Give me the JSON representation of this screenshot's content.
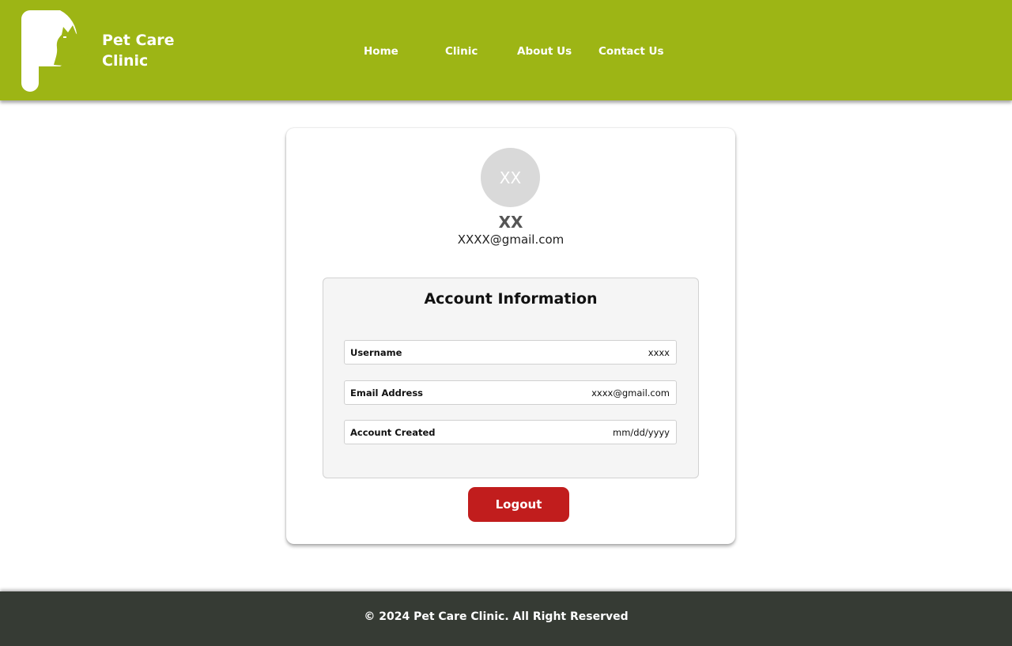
{
  "brand": {
    "line1": "Pet Care",
    "line2": "Clinic",
    "logo_icon": "pet-clinic-logo-icon"
  },
  "nav": {
    "items": [
      {
        "label": "Home"
      },
      {
        "label": "Clinic"
      },
      {
        "label": "About Us"
      },
      {
        "label": "Contact Us"
      }
    ]
  },
  "profile": {
    "avatar_initials": "XX",
    "name": "XX",
    "email": "XXXX@gmail.com"
  },
  "account_info": {
    "title": "Account Information",
    "rows": [
      {
        "label": "Username",
        "value": "xxxx"
      },
      {
        "label": "Email Address",
        "value": "xxxx@gmail.com"
      },
      {
        "label": "Account Created",
        "value": "mm/dd/yyyy"
      }
    ]
  },
  "actions": {
    "logout_label": "Logout"
  },
  "footer": {
    "text": "© 2024 Pet Care Clinic. All Right Reserved"
  },
  "colors": {
    "header_bg": "#9db515",
    "footer_bg": "#363b34",
    "logout_bg": "#c11d1d",
    "avatar_bg": "#d9d9d9"
  }
}
